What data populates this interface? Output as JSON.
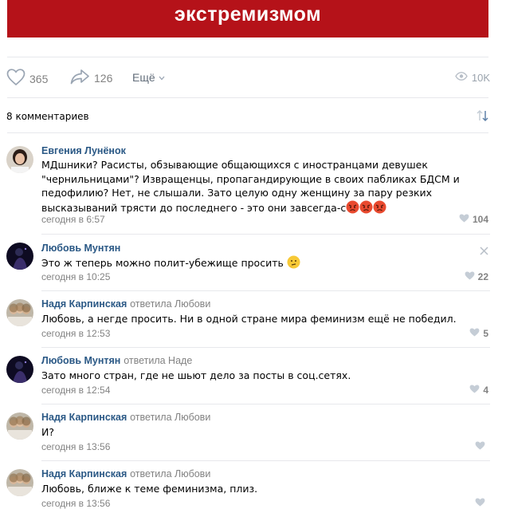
{
  "banner": {
    "text": "экстремизмом"
  },
  "actions": {
    "likes": "365",
    "shares": "126",
    "more": "Ещё",
    "views": "10K"
  },
  "comments_header": "8 комментариев",
  "comments": [
    {
      "author": "Евгения Лунёнок",
      "reply_to": "",
      "text": "МДшники? Расисты, обзывающие общающихся с иностранцами девушек \"чернильницами\"? Извращенцы, пропагандирующие в своих пабликах БДСМ и педофилию? Нет, не слышали. Зато целую одну женщину за пару резких высказываний трясти до последнего - это они завсегда-с",
      "time": "сегодня в 6:57",
      "likes": "104",
      "emoji_icons": [
        "angry-face-icon",
        "angry-face-icon",
        "angry-face-icon"
      ]
    },
    {
      "author": "Любовь Мунтян",
      "reply_to": "",
      "text": "Это ж теперь можно полит-убежище просить",
      "time": "сегодня в 10:25",
      "likes": "22",
      "emoji_icons": [
        "thinking-face-icon"
      ]
    },
    {
      "author": "Надя Карпинская",
      "reply_to": "ответила Любови",
      "text": "Любовь, а негде просить. Ни в одной стране мира феминизм ещё не победил.",
      "time": "сегодня в 12:53",
      "likes": "5"
    },
    {
      "author": "Любовь Мунтян",
      "reply_to": "ответила Наде",
      "text": "Зато много стран, где не шьют дело за посты в соц.сетях.",
      "time": "сегодня в 12:54",
      "likes": "4"
    },
    {
      "author": "Надя Карпинская",
      "reply_to": "ответила Любови",
      "text": "И?",
      "time": "сегодня в 13:56",
      "likes": ""
    },
    {
      "author": "Надя Карпинская",
      "reply_to": "ответила Любови",
      "text": "Любовь, ближе к теме феминизма, плиз.",
      "time": "сегодня в 13:56",
      "likes": ""
    }
  ],
  "colors": {
    "banner": "#b51219",
    "link": "#2a5885",
    "muted": "#828282",
    "divider": "#e7e8ec"
  }
}
